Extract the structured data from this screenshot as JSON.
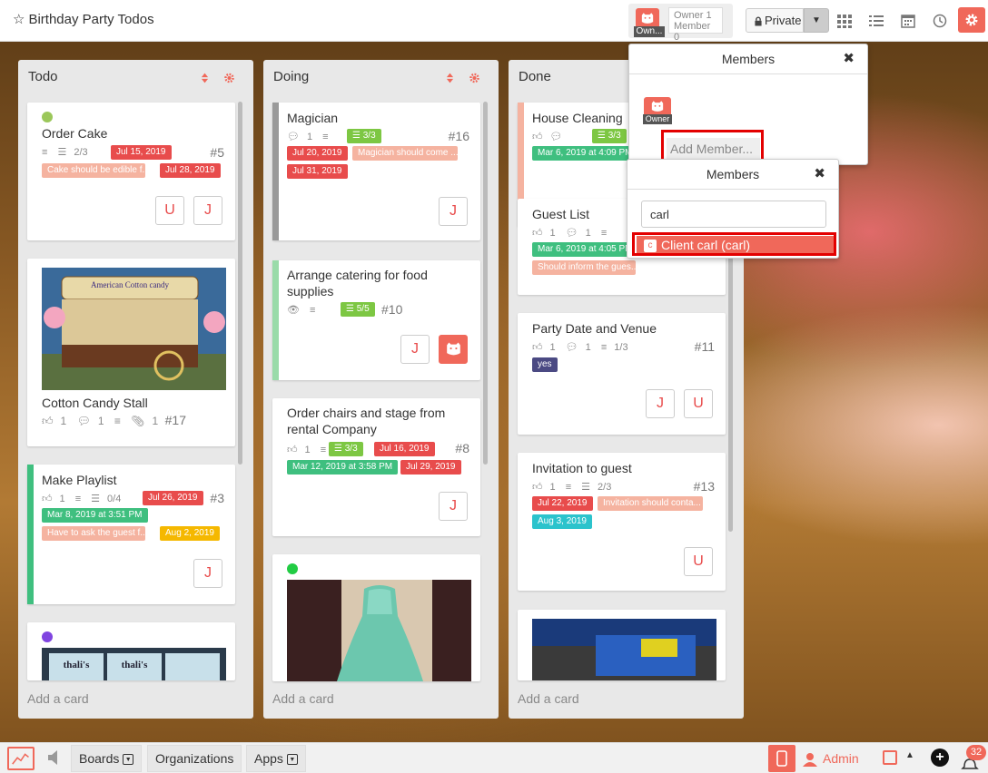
{
  "header": {
    "board_title": "Birthday Party Todos",
    "owner_tag": "Own...",
    "owner_count": "Owner 1",
    "member_count": "Member 0",
    "visibility": "Private"
  },
  "lists": [
    {
      "title": "Todo",
      "add_card": "Add a card",
      "cards": [
        {
          "title": "Order Cake",
          "checklist": "2/3",
          "due": "Jul 15, 2019",
          "num": "#5",
          "note": "Cake should be edible f...",
          "end": "Jul 28, 2019",
          "avatars": [
            "U",
            "J"
          ]
        },
        {
          "title": "Cotton Candy Stall",
          "likes": "1",
          "comments": "1",
          "attachments": "1",
          "num": "#17",
          "image_text": "American Cotton candy"
        },
        {
          "title": "Make Playlist",
          "likes": "1",
          "checklist": "0/4",
          "due": "Jul 26, 2019",
          "num": "#3",
          "created": "Mar 8, 2019 at 3:51 PM",
          "note": "Have to ask the guest f...",
          "end": "Aug 2, 2019",
          "avatars": [
            "J"
          ]
        },
        {
          "image_text": "thali's"
        }
      ]
    },
    {
      "title": "Doing",
      "add_card": "Add a card",
      "cards": [
        {
          "title": "Magician",
          "comments": "1",
          "checklist": "3/3",
          "num": "#16",
          "due": "Jul 20, 2019",
          "note": "Magician should come ...",
          "end": "Jul 31, 2019",
          "avatars": [
            "J"
          ]
        },
        {
          "title": "Arrange catering for food supplies",
          "checklist": "5/5",
          "num": "#10",
          "avatars": [
            "J"
          ]
        },
        {
          "title": "Order chairs and stage from rental Company",
          "likes": "1",
          "checklist": "3/3",
          "due": "Jul 16, 2019",
          "num": "#8",
          "created": "Mar 12, 2019 at 3:58 PM",
          "end": "Jul 29, 2019",
          "avatars": [
            "J"
          ]
        },
        {}
      ]
    },
    {
      "title": "Done",
      "add_card": "Add a card",
      "cards": [
        {
          "title": "House Cleaning",
          "checklist": "3/3",
          "created": "Mar 6, 2019 at 4:09 PM"
        },
        {
          "title": "Guest List",
          "likes": "1",
          "comments": "1",
          "created": "Mar 6, 2019 at 4:05 PM",
          "note": "Should inform the gues..."
        },
        {
          "title": "Party Date and Venue",
          "likes": "1",
          "comments": "1",
          "checklist": "1/3",
          "num": "#11",
          "label": "yes",
          "avatars": [
            "J",
            "U"
          ]
        },
        {
          "title": "Invitation to guest",
          "likes": "1",
          "checklist": "2/3",
          "num": "#13",
          "due": "Jul 22, 2019",
          "note": "Invitation should conta...",
          "end": "Aug 3, 2019",
          "avatars": [
            "U"
          ]
        },
        {}
      ]
    }
  ],
  "members_popup": {
    "title": "Members",
    "owner_tag": "Owner",
    "add_member": "Add Member..."
  },
  "search_popup": {
    "title": "Members",
    "query": "carl",
    "result_initial": "c",
    "result": "Client carl (carl)"
  },
  "footer": {
    "boards": "Boards",
    "organizations": "Organizations",
    "apps": "Apps",
    "admin": "Admin",
    "notifications": "32"
  },
  "colors": {
    "accent": "#f0685a",
    "label_red": "#e84c4c",
    "label_green": "#3fbf7f",
    "highlight": "#e30000"
  }
}
